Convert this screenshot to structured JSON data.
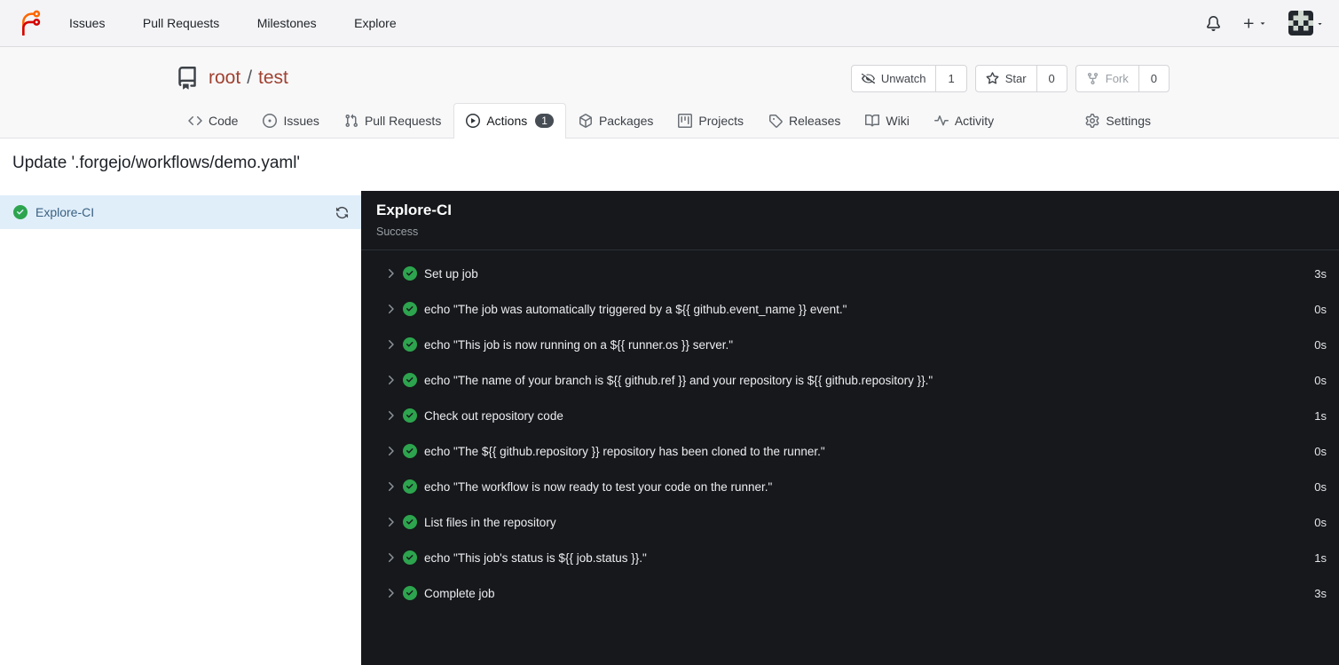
{
  "colors": {
    "logo_orange": "#ff6600",
    "logo_red": "#d40000",
    "success_green": "#2da44e",
    "selected_job_bg": "#e0eefa",
    "panel_bg": "#16181b",
    "repo_link_red": "#a04231"
  },
  "navbar": {
    "links": [
      "Issues",
      "Pull Requests",
      "Milestones",
      "Explore"
    ],
    "icons": [
      "forgejo-logo-icon",
      "bell-icon",
      "plus-icon",
      "caret-down-icon",
      "avatar"
    ]
  },
  "repo": {
    "owner": "root",
    "separator": "/",
    "name": "test",
    "icon": "repo-book-icon",
    "actions": {
      "watch": {
        "label": "Unwatch",
        "count": "1",
        "icon": "eye-slash-icon"
      },
      "star": {
        "label": "Star",
        "count": "0",
        "icon": "star-icon"
      },
      "fork": {
        "label": "Fork",
        "count": "0",
        "icon": "git-fork-icon"
      }
    },
    "tabs": [
      {
        "label": "Code",
        "icon": "code-icon"
      },
      {
        "label": "Issues",
        "icon": "issue-opened-icon"
      },
      {
        "label": "Pull Requests",
        "icon": "git-pull-request-icon"
      },
      {
        "label": "Actions",
        "icon": "play-circle-icon",
        "badge": "1",
        "active": true
      },
      {
        "label": "Packages",
        "icon": "package-icon"
      },
      {
        "label": "Projects",
        "icon": "project-board-icon"
      },
      {
        "label": "Releases",
        "icon": "tag-icon"
      },
      {
        "label": "Wiki",
        "icon": "book-open-icon"
      },
      {
        "label": "Activity",
        "icon": "pulse-icon"
      },
      {
        "label": "Settings",
        "icon": "gear-icon"
      }
    ]
  },
  "run": {
    "title": "Update '.forgejo/workflows/demo.yaml'",
    "jobs": [
      {
        "name": "Explore-CI",
        "status": "success",
        "icons": [
          "check-circle-icon",
          "sync-icon"
        ]
      }
    ],
    "panel": {
      "title": "Explore-CI",
      "status": "Success",
      "steps": [
        {
          "name": "Set up job",
          "duration": "3s"
        },
        {
          "name": "echo \"The job was automatically triggered by a ${{ github.event_name }} event.\"",
          "duration": "0s"
        },
        {
          "name": "echo \"This job is now running on a ${{ runner.os }} server.\"",
          "duration": "0s"
        },
        {
          "name": "echo \"The name of your branch is ${{ github.ref }} and your repository is ${{ github.repository }}.\"",
          "duration": "0s"
        },
        {
          "name": "Check out repository code",
          "duration": "1s"
        },
        {
          "name": "echo \"The ${{ github.repository }} repository has been cloned to the runner.\"",
          "duration": "0s"
        },
        {
          "name": "echo \"The workflow is now ready to test your code on the runner.\"",
          "duration": "0s"
        },
        {
          "name": "List files in the repository",
          "duration": "0s"
        },
        {
          "name": "echo \"This job's status is ${{ job.status }}.\"",
          "duration": "1s"
        },
        {
          "name": "Complete job",
          "duration": "3s"
        }
      ]
    }
  }
}
